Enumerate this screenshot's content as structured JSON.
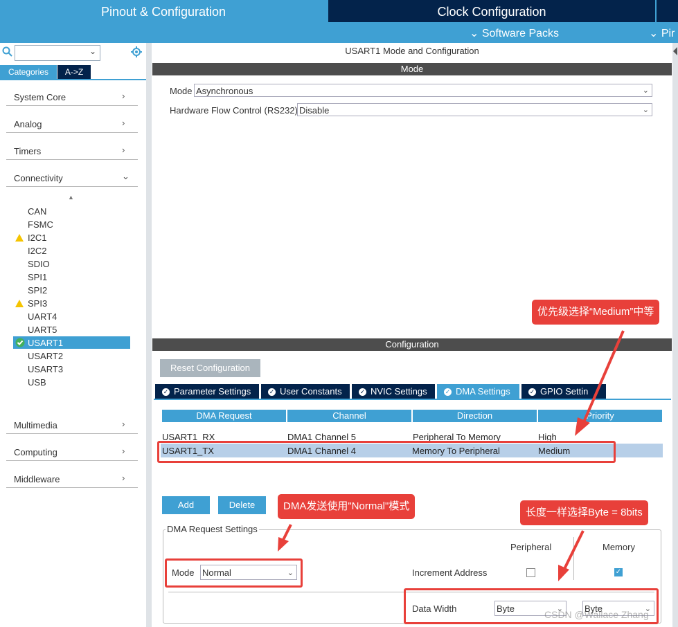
{
  "tabs": {
    "pinout": "Pinout & Configuration",
    "clock": "Clock Configuration",
    "software_packs": "Software Packs",
    "pinout_short": "Pir"
  },
  "left": {
    "categories_tab": "Categories",
    "az_tab": "A->Z",
    "groups": [
      "System Core",
      "Analog",
      "Timers",
      "Connectivity",
      "Multimedia",
      "Computing",
      "Middleware"
    ],
    "connectivity_items": [
      "CAN",
      "FSMC",
      "I2C1",
      "I2C2",
      "SDIO",
      "SPI1",
      "SPI2",
      "SPI3",
      "UART4",
      "UART5",
      "USART1",
      "USART2",
      "USART3",
      "USB"
    ]
  },
  "mode": {
    "title": "USART1 Mode and Configuration",
    "bar": "Mode",
    "mode_label": "Mode",
    "mode_value": "Asynchronous",
    "hw_label": "Hardware Flow Control (RS232)",
    "hw_value": "Disable"
  },
  "config": {
    "bar": "Configuration",
    "reset": "Reset Configuration",
    "tabs": [
      "Parameter Settings",
      "User Constants",
      "NVIC Settings",
      "DMA Settings",
      "GPIO Settin"
    ],
    "headers": [
      "DMA Request",
      "Channel",
      "Direction",
      "Priority"
    ],
    "rows": [
      [
        "USART1_RX",
        "DMA1 Channel 5",
        "Peripheral To Memory",
        "High"
      ],
      [
        "USART1_TX",
        "DMA1 Channel 4",
        "Memory To Peripheral",
        "Medium"
      ]
    ],
    "add": "Add",
    "delete": "Delete",
    "req_settings": "DMA Request Settings",
    "peripheral": "Peripheral",
    "memory": "Memory",
    "mode_label": "Mode",
    "mode_value": "Normal",
    "inc_addr": "Increment Address",
    "data_width": "Data Width",
    "dw_periph": "Byte",
    "dw_mem": "Byte"
  },
  "annotations": {
    "priority": "优先级选择“Medium”中等",
    "mode": "DMA发送使用\"Normal\"模式",
    "width": "长度一样选择Byte = 8bits"
  },
  "watermark": "CSDN @Wallace Zhang",
  "colors": {
    "accent": "#3fa0d3",
    "navy": "#03234b",
    "red": "#e8403a",
    "select_row": "#b7cfe8"
  }
}
